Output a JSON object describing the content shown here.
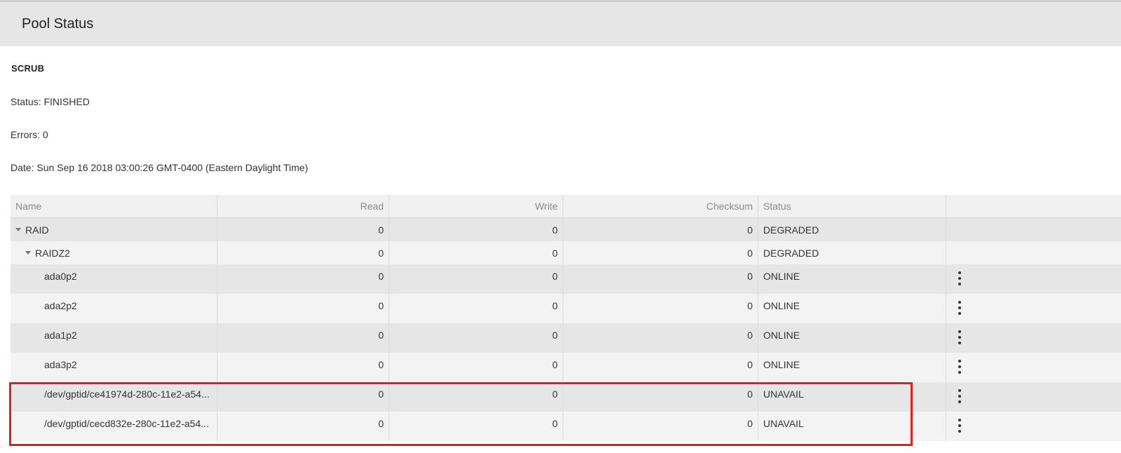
{
  "page": {
    "title": "Pool Status"
  },
  "scrub": {
    "label": "SCRUB",
    "status": "Status: FINISHED",
    "errors": "Errors: 0",
    "date": "Date: Sun Sep 16 2018 03:00:26 GMT-0400 (Eastern Daylight Time)"
  },
  "table": {
    "headers": {
      "name": "Name",
      "read": "Read",
      "write": "Write",
      "checksum": "Checksum",
      "status": "Status"
    },
    "rows": [
      {
        "name": "RAID",
        "read": "0",
        "write": "0",
        "checksum": "0",
        "status": "DEGRADED"
      },
      {
        "name": "RAIDZ2",
        "read": "0",
        "write": "0",
        "checksum": "0",
        "status": "DEGRADED"
      },
      {
        "name": "ada0p2",
        "read": "0",
        "write": "0",
        "checksum": "0",
        "status": "ONLINE"
      },
      {
        "name": "ada2p2",
        "read": "0",
        "write": "0",
        "checksum": "0",
        "status": "ONLINE"
      },
      {
        "name": "ada1p2",
        "read": "0",
        "write": "0",
        "checksum": "0",
        "status": "ONLINE"
      },
      {
        "name": "ada3p2",
        "read": "0",
        "write": "0",
        "checksum": "0",
        "status": "ONLINE"
      },
      {
        "name": "/dev/gptid/ce41974d-280c-11e2-a54...",
        "read": "0",
        "write": "0",
        "checksum": "0",
        "status": "UNAVAIL"
      },
      {
        "name": "/dev/gptid/cecd832e-280c-11e2-a54...",
        "read": "0",
        "write": "0",
        "checksum": "0",
        "status": "UNAVAIL"
      }
    ]
  },
  "icons": {
    "expand": "caret-down-icon",
    "actions": "more-vert-icon"
  },
  "colors": {
    "highlight": "#e0201f",
    "header_bg": "#e6e6e6"
  }
}
